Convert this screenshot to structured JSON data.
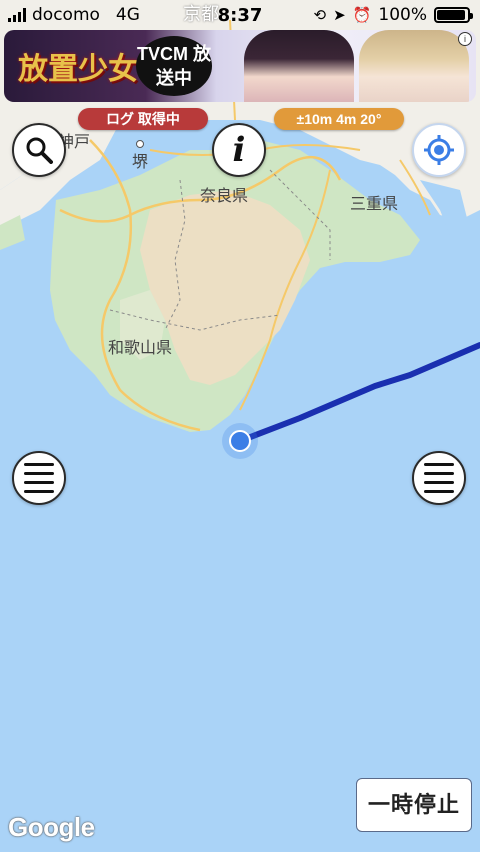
{
  "status_bar": {
    "carrier": "docomo",
    "network": "4G",
    "time": "8:37",
    "battery": "100%",
    "battery_level": 1.0
  },
  "ad": {
    "logo_text": "放置少女",
    "bubble_text": "TVCM 放送中"
  },
  "badges": {
    "log_status": "ログ 取得中",
    "log_color": "#b83a3a",
    "accuracy": "±10m 4m 20°",
    "accuracy_color": "#e19a3a"
  },
  "map": {
    "labels": {
      "kyoto": "京都",
      "kobe": "神戸",
      "sakai": "堺",
      "nara": "奈良県",
      "mie": "三重県",
      "wakayama": "和歌山県"
    },
    "track_color": "#1a2fb0",
    "location_color": "#3b7ee6"
  },
  "buttons": {
    "pause_label": "一時停止",
    "info_glyph": "i"
  },
  "attribution": "Google"
}
